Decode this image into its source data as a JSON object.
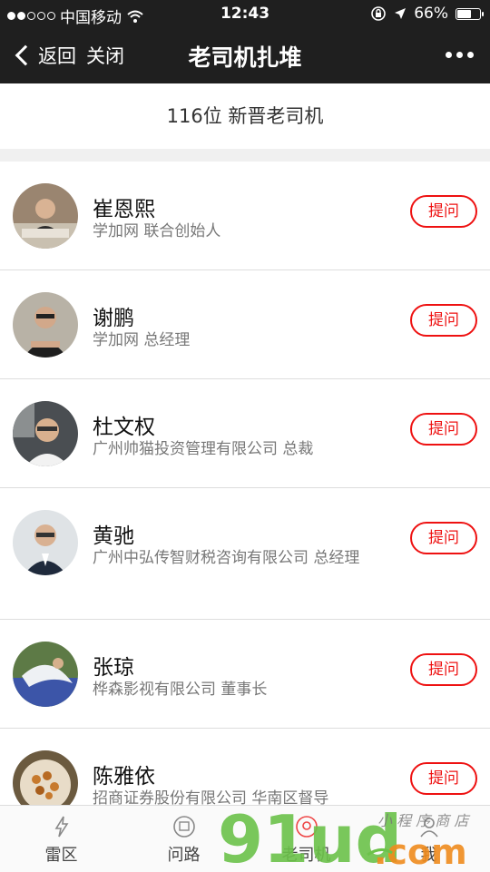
{
  "status_bar": {
    "carrier": "中国移动",
    "time": "12:43",
    "battery": "66%",
    "battery_level": 0.66
  },
  "nav": {
    "back_label": "返回",
    "close_label": "关闭",
    "title": "老司机扎堆",
    "more_icon": "more-icon"
  },
  "header": {
    "count_text": "116位 新晋老司机"
  },
  "drivers": [
    {
      "name": "崔恩熙",
      "desc": "学加网 联合创始人",
      "ask_label": "提问"
    },
    {
      "name": "谢鹏",
      "desc": "学加网 总经理",
      "ask_label": "提问"
    },
    {
      "name": "杜文权",
      "desc": "广州帅猫投资管理有限公司 总裁",
      "ask_label": "提问"
    },
    {
      "name": "黄驰",
      "desc": "广州中弘传智财税咨询有限公司 总经理",
      "ask_label": "提问"
    },
    {
      "name": "张琼",
      "desc": "桦森影视有限公司 董事长",
      "ask_label": "提问"
    },
    {
      "name": "陈雅依",
      "desc": "招商证券股份有限公司 华南区督导",
      "ask_label": "提问"
    }
  ],
  "tabs": [
    {
      "label": "雷区",
      "icon": "lightning-icon"
    },
    {
      "label": "问路",
      "icon": "question-bubble-icon"
    },
    {
      "label": "老司机",
      "icon": "driver-icon"
    },
    {
      "label": "我",
      "icon": "user-icon"
    }
  ],
  "watermark": {
    "logo": "91ud.com",
    "script": "小程序商店"
  },
  "colors": {
    "accent": "#ee1111",
    "bar_bg": "#1f1f1f",
    "watermark_green": "#6cc24a",
    "watermark_orange": "#f08c1e"
  }
}
